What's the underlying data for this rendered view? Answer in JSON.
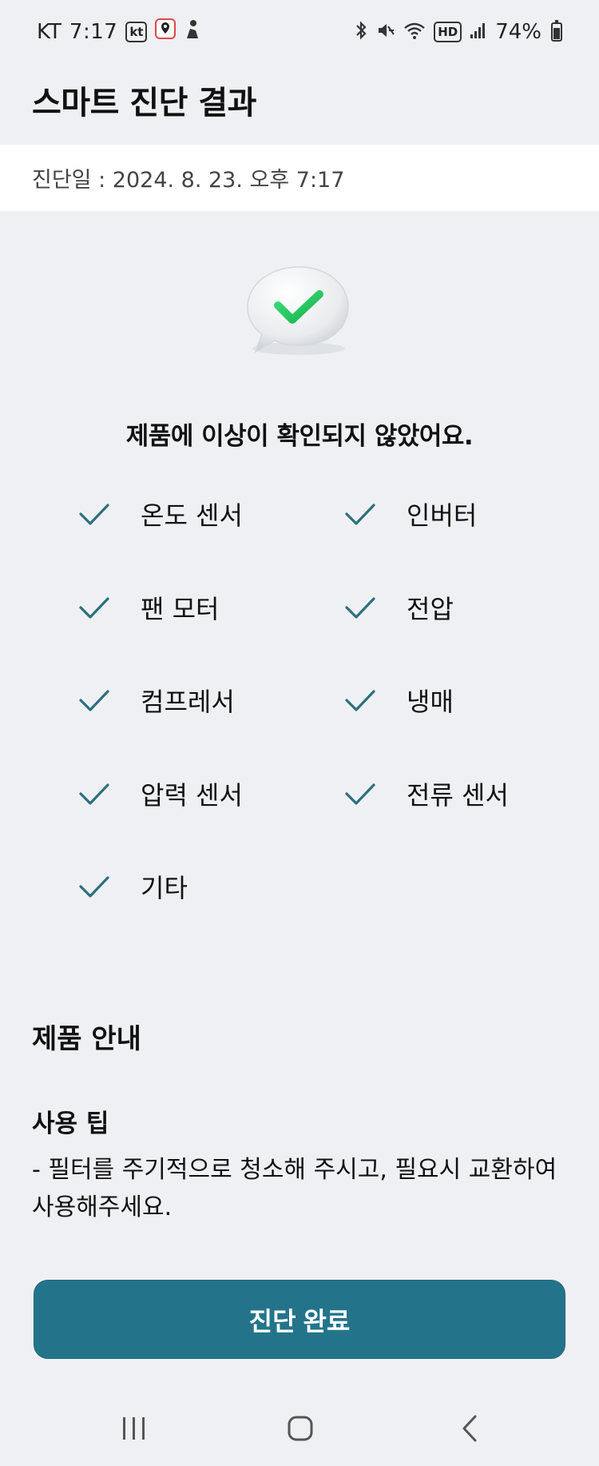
{
  "status_bar": {
    "carrier": "KT",
    "time": "7:17",
    "app_badge": "kt",
    "battery_percent": "74%"
  },
  "header": {
    "title": "스마트 진단 결과"
  },
  "diagnosis": {
    "date_text": "진단일 : 2024. 8. 23. 오후 7:17",
    "result_message": "제품에 이상이 확인되지 않았어요."
  },
  "checks": [
    {
      "label": "온도 센서",
      "status": "ok"
    },
    {
      "label": "인버터",
      "status": "ok"
    },
    {
      "label": "팬 모터",
      "status": "ok"
    },
    {
      "label": "전압",
      "status": "ok"
    },
    {
      "label": "컴프레서",
      "status": "ok"
    },
    {
      "label": "냉매",
      "status": "ok"
    },
    {
      "label": "압력 센서",
      "status": "ok"
    },
    {
      "label": "전류 센서",
      "status": "ok"
    },
    {
      "label": "기타",
      "status": "ok"
    }
  ],
  "product_info": {
    "section_title": "제품 안내",
    "tip_title": "사용 팁",
    "tip_body": "- 필터를 주기적으로 청소해 주시고, 필요시 교환하여 사용해주세요."
  },
  "actions": {
    "done_label": "진단 완료"
  },
  "colors": {
    "background": "#eff0f4",
    "primary": "#23748b",
    "check": "#2b6f7c",
    "success_green": "#22c25a"
  },
  "icons": {
    "result": "speech-bubble-check-icon",
    "check": "check-icon",
    "nav_recent": "recent-apps-icon",
    "nav_home": "home-icon",
    "nav_back": "back-icon"
  }
}
